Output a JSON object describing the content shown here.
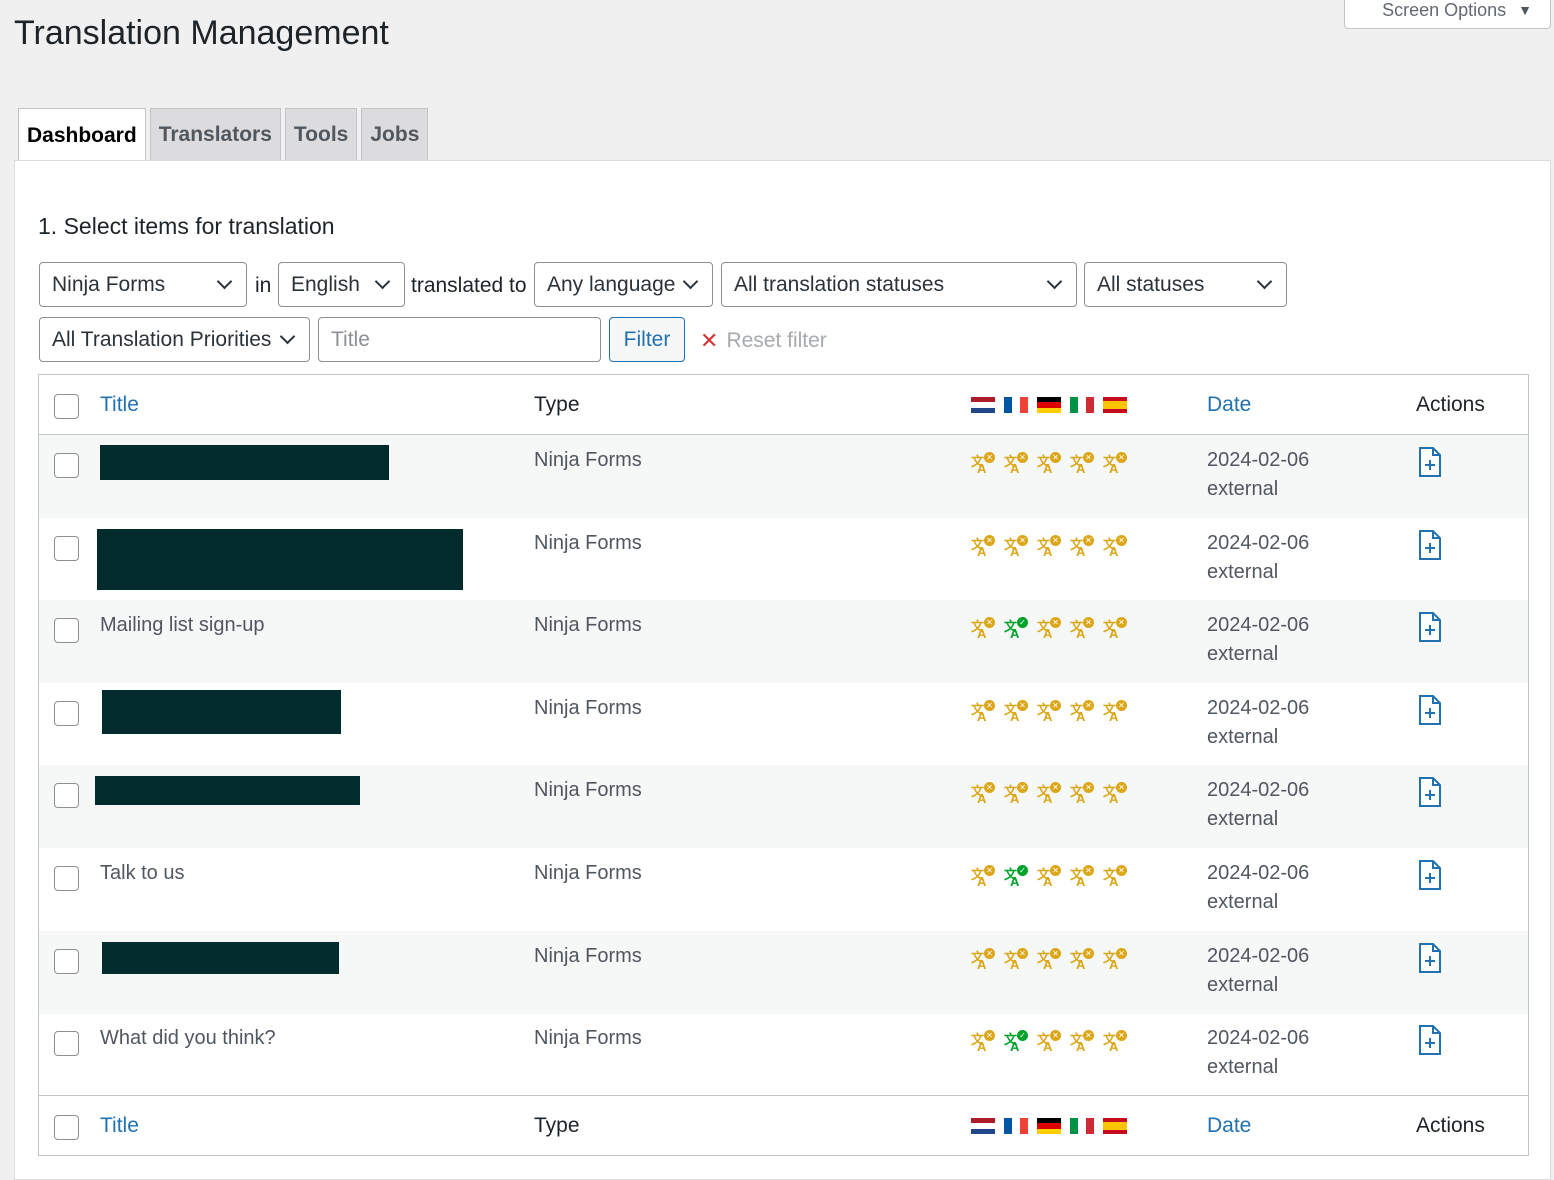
{
  "screen_options": {
    "label": "Screen Options"
  },
  "page": {
    "title": "Translation Management"
  },
  "tabs": [
    {
      "label": "Dashboard",
      "active": true
    },
    {
      "label": "Translators",
      "active": false
    },
    {
      "label": "Tools",
      "active": false
    },
    {
      "label": "Jobs",
      "active": false
    }
  ],
  "section": {
    "title": "1. Select items for translation"
  },
  "filters": {
    "type": "Ninja Forms",
    "in_label": "in",
    "source_language": "English",
    "translated_to_label": "translated to",
    "target_language": "Any language",
    "translation_status": "All translation statuses",
    "status": "All statuses",
    "priority": "All Translation Priorities",
    "title_placeholder": "Title",
    "filter_button": "Filter",
    "reset_label": "Reset filter"
  },
  "table": {
    "columns": {
      "title": "Title",
      "type": "Type",
      "date": "Date",
      "actions": "Actions"
    },
    "languages": [
      "nl",
      "fr",
      "de",
      "it",
      "es"
    ],
    "rows": [
      {
        "title": "",
        "type": "Ninja Forms",
        "date": "2024-02-06",
        "source": "external",
        "statuses": [
          "not-translated",
          "not-translated",
          "not-translated",
          "not-translated",
          "not-translated"
        ]
      },
      {
        "title": "",
        "type": "Ninja Forms",
        "date": "2024-02-06",
        "source": "external",
        "statuses": [
          "not-translated",
          "not-translated",
          "not-translated",
          "not-translated",
          "not-translated"
        ]
      },
      {
        "title": "Mailing list sign-up",
        "type": "Ninja Forms",
        "date": "2024-02-06",
        "source": "external",
        "statuses": [
          "not-translated",
          "translated",
          "not-translated",
          "not-translated",
          "not-translated"
        ]
      },
      {
        "title": "",
        "type": "Ninja Forms",
        "date": "2024-02-06",
        "source": "external",
        "statuses": [
          "not-translated",
          "not-translated",
          "not-translated",
          "not-translated",
          "not-translated"
        ]
      },
      {
        "title": "",
        "type": "Ninja Forms",
        "date": "2024-02-06",
        "source": "external",
        "statuses": [
          "not-translated",
          "not-translated",
          "not-translated",
          "not-translated",
          "not-translated"
        ]
      },
      {
        "title": "Talk to us",
        "type": "Ninja Forms",
        "date": "2024-02-06",
        "source": "external",
        "statuses": [
          "not-translated",
          "translated",
          "not-translated",
          "not-translated",
          "not-translated"
        ]
      },
      {
        "title": "",
        "type": "Ninja Forms",
        "date": "2024-02-06",
        "source": "external",
        "statuses": [
          "not-translated",
          "not-translated",
          "not-translated",
          "not-translated",
          "not-translated"
        ]
      },
      {
        "title": "What did you think?",
        "type": "Ninja Forms",
        "date": "2024-02-06",
        "source": "external",
        "statuses": [
          "not-translated",
          "translated",
          "not-translated",
          "not-translated",
          "not-translated"
        ]
      }
    ]
  },
  "colors": {
    "link": "#2271b1",
    "not_translated": "#dba617",
    "translated": "#00a32a",
    "redaction": "#022b2b"
  }
}
